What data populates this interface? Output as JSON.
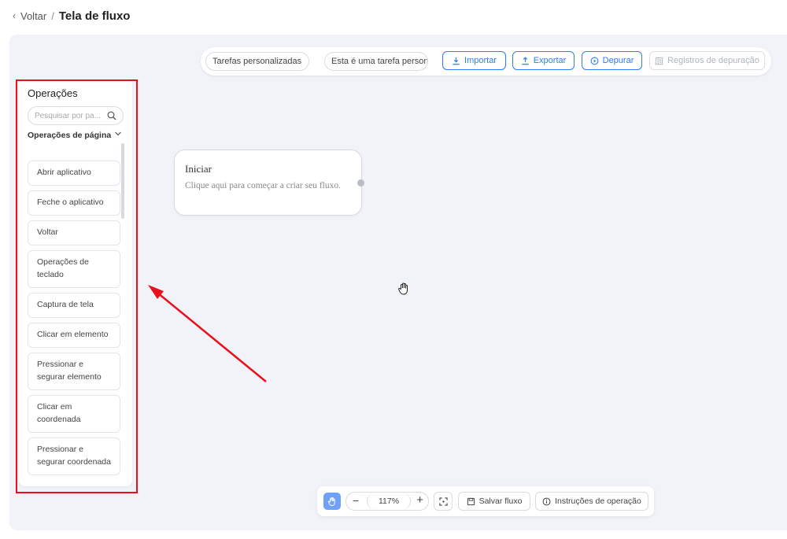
{
  "header": {
    "back_label": "Voltar",
    "separator": "/",
    "title": "Tela de fluxo"
  },
  "toolbar": {
    "task_name": "Tarefas personalizadas",
    "task_desc": "Esta é uma tarefa personalizada",
    "import_label": "Importar",
    "export_label": "Exportar",
    "debug_label": "Depurar",
    "debug_logs_label": "Registros de depuração"
  },
  "ops": {
    "title": "Operações",
    "search_placeholder": "Pesquisar por pa...",
    "group_label": "Operações de página",
    "items": [
      "Abrir aplicativo",
      "Feche o aplicativo",
      "Voltar",
      "Operações de teclado",
      "Captura de tela",
      "Clicar em elemento",
      "Pressionar e segurar elemento",
      "Clicar em coordenada",
      "Pressionar e segurar coordenada"
    ]
  },
  "node": {
    "title": "Iniciar",
    "desc": "Clique aqui para começar a criar seu fluxo."
  },
  "bottom": {
    "zoom": "117%",
    "save_label": "Salvar fluxo",
    "instructions_label": "Instruções de operação"
  },
  "colors": {
    "accent": "#2e7cf6",
    "highlight": "#e8101b",
    "canvas_bg": "#f1f3f9"
  },
  "icons": [
    "chevron-left-icon",
    "download-icon",
    "upload-icon",
    "play-icon",
    "log-icon",
    "search-icon",
    "chevron-down-icon",
    "hand-icon",
    "fit-screen-icon",
    "save-icon",
    "info-icon"
  ]
}
